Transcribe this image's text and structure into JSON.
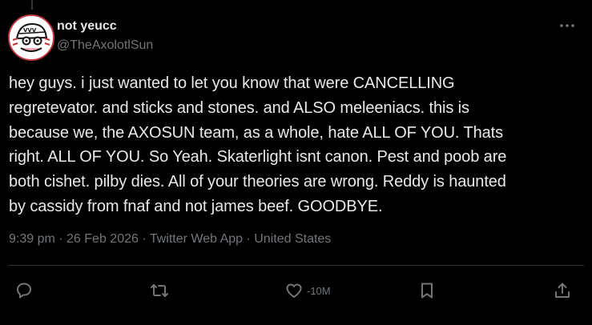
{
  "author": {
    "display_name": "not yeucc",
    "handle": "@TheAxolotlSun"
  },
  "tweet": {
    "text": "hey guys. i just wanted to let you know that were CANCELLING\nregretevator. and sticks and stones. and ALSO meleeniacs. this is\nbecause we, the AXOSUN team, as a whole, hate ALL OF YOU. Thats\nright. ALL OF YOU. So Yeah. Skaterlight isnt canon. Pest and poob are\nboth cishet. pilby dies. All of your theories are wrong. Reddy is haunted\nby cassidy from fnaf and not james beef. GOODBYE."
  },
  "meta": {
    "time": "9:39 pm",
    "separator": " · ",
    "date": "26 Feb 2026",
    "source": "Twitter Web App",
    "location": "United States"
  },
  "actions": {
    "reply_icon": "reply-icon",
    "retweet_icon": "retweet-icon",
    "like_icon": "heart-icon",
    "like_count": "-10M",
    "bookmark_icon": "bookmark-icon",
    "share_icon": "share-icon"
  },
  "colors": {
    "background": "#000000",
    "text_primary": "#e7e9ea",
    "text_secondary": "#71767b",
    "divider": "#2f3336",
    "avatar_border": "#c4333b"
  }
}
